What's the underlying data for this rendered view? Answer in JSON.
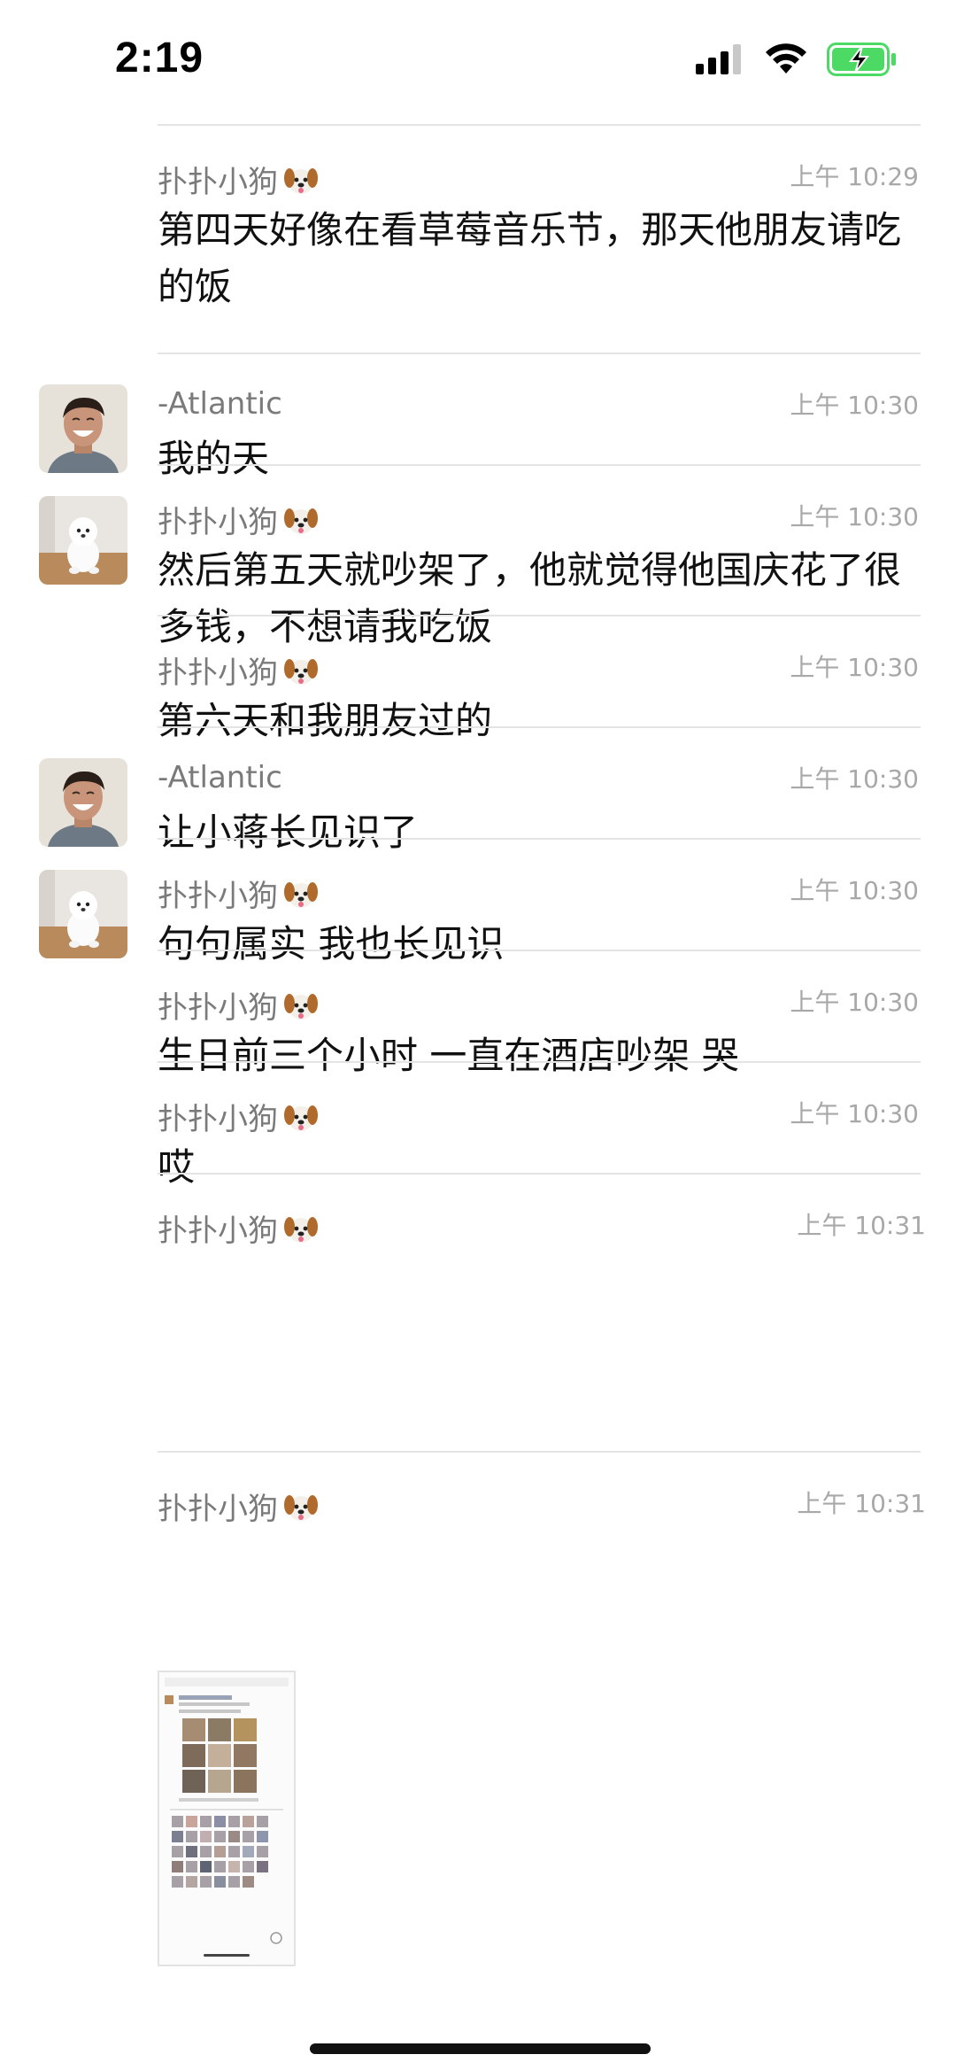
{
  "status_bar": {
    "time": "2:19",
    "icons": [
      "cellular-signal-icon",
      "wifi-icon",
      "battery-charging-icon"
    ],
    "battery_color": "#4cd964"
  },
  "messages": [
    {
      "sender": "扑扑小狗",
      "sender_emoji": "dog-face-emoji",
      "time": "上午 10:29",
      "text": "第四天好像在看草莓音乐节，那天他朋友请吃的饭",
      "avatar": "none"
    },
    {
      "sender": "-Atlantic",
      "time": "上午 10:30",
      "text": "我的天",
      "avatar": "man-laughing-avatar"
    },
    {
      "sender": "扑扑小狗",
      "sender_emoji": "dog-face-emoji",
      "time": "上午 10:30",
      "text": "然后第五天就吵架了，他就觉得他国庆花了很多钱，不想请我吃饭",
      "avatar": "white-puppy-avatar"
    },
    {
      "sender": "扑扑小狗",
      "sender_emoji": "dog-face-emoji",
      "time": "上午 10:30",
      "text": "第六天和我朋友过的",
      "avatar": "none"
    },
    {
      "sender": "-Atlantic",
      "time": "上午 10:30",
      "text": "让小蒋长见识了",
      "avatar": "man-laughing-avatar"
    },
    {
      "sender": "扑扑小狗",
      "sender_emoji": "dog-face-emoji",
      "time": "上午 10:30",
      "text": "句句属实 我也长见识",
      "avatar": "white-puppy-avatar"
    },
    {
      "sender": "扑扑小狗",
      "sender_emoji": "dog-face-emoji",
      "time": "上午 10:30",
      "text": "生日前三个小时 一直在酒店吵架 哭",
      "avatar": "none"
    },
    {
      "sender": "扑扑小狗",
      "sender_emoji": "dog-face-emoji",
      "time": "上午 10:30",
      "text": "哎",
      "avatar": "none"
    },
    {
      "sender": "扑扑小狗",
      "sender_emoji": "dog-face-emoji",
      "time": "上午 10:31",
      "image": "screenshot-thumbnail",
      "avatar": "none"
    },
    {
      "sender": "扑扑小狗",
      "sender_emoji": "dog-face-emoji",
      "time": "上午 10:31",
      "avatar": "none"
    }
  ]
}
